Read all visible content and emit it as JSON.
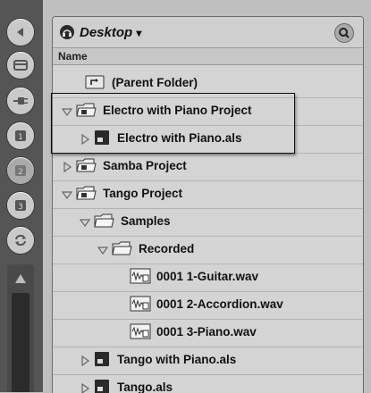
{
  "browser": {
    "location": "Desktop",
    "location_caret": "▾",
    "column_header": "Name"
  },
  "rows": [
    {
      "label": "(Parent Folder)",
      "icon": "parent-folder-icon",
      "depth": 0,
      "arrow": "none"
    },
    {
      "label": "Electro with Piano Project",
      "icon": "project-folder-icon",
      "depth": 0,
      "arrow": "expanded"
    },
    {
      "label": "Electro with Piano.als",
      "icon": "live-set-icon",
      "depth": 1,
      "arrow": "collapsed"
    },
    {
      "label": "Samba Project",
      "icon": "project-folder-icon",
      "depth": 0,
      "arrow": "collapsed"
    },
    {
      "label": "Tango Project",
      "icon": "project-folder-icon",
      "depth": 0,
      "arrow": "expanded"
    },
    {
      "label": "Samples",
      "icon": "folder-icon",
      "depth": 1,
      "arrow": "expanded"
    },
    {
      "label": "Recorded",
      "icon": "folder-icon",
      "depth": 2,
      "arrow": "expanded"
    },
    {
      "label": "0001 1-Guitar.wav",
      "icon": "audio-file-icon",
      "depth": 3,
      "arrow": "none"
    },
    {
      "label": "0001 2-Accordion.wav",
      "icon": "audio-file-icon",
      "depth": 3,
      "arrow": "none"
    },
    {
      "label": "0001 3-Piano.wav",
      "icon": "audio-file-icon",
      "depth": 3,
      "arrow": "none"
    },
    {
      "label": "Tango with Piano.als",
      "icon": "live-set-icon",
      "depth": 1,
      "arrow": "collapsed"
    },
    {
      "label": "Tango.als",
      "icon": "live-set-icon",
      "depth": 1,
      "arrow": "collapsed"
    }
  ],
  "sidebar_buttons": [
    "hide-browser-icon",
    "device-browser-icon",
    "plugin-browser-icon",
    "file-browser-1-icon",
    "file-browser-2-icon",
    "file-browser-3-icon",
    "hot-swap-icon"
  ]
}
